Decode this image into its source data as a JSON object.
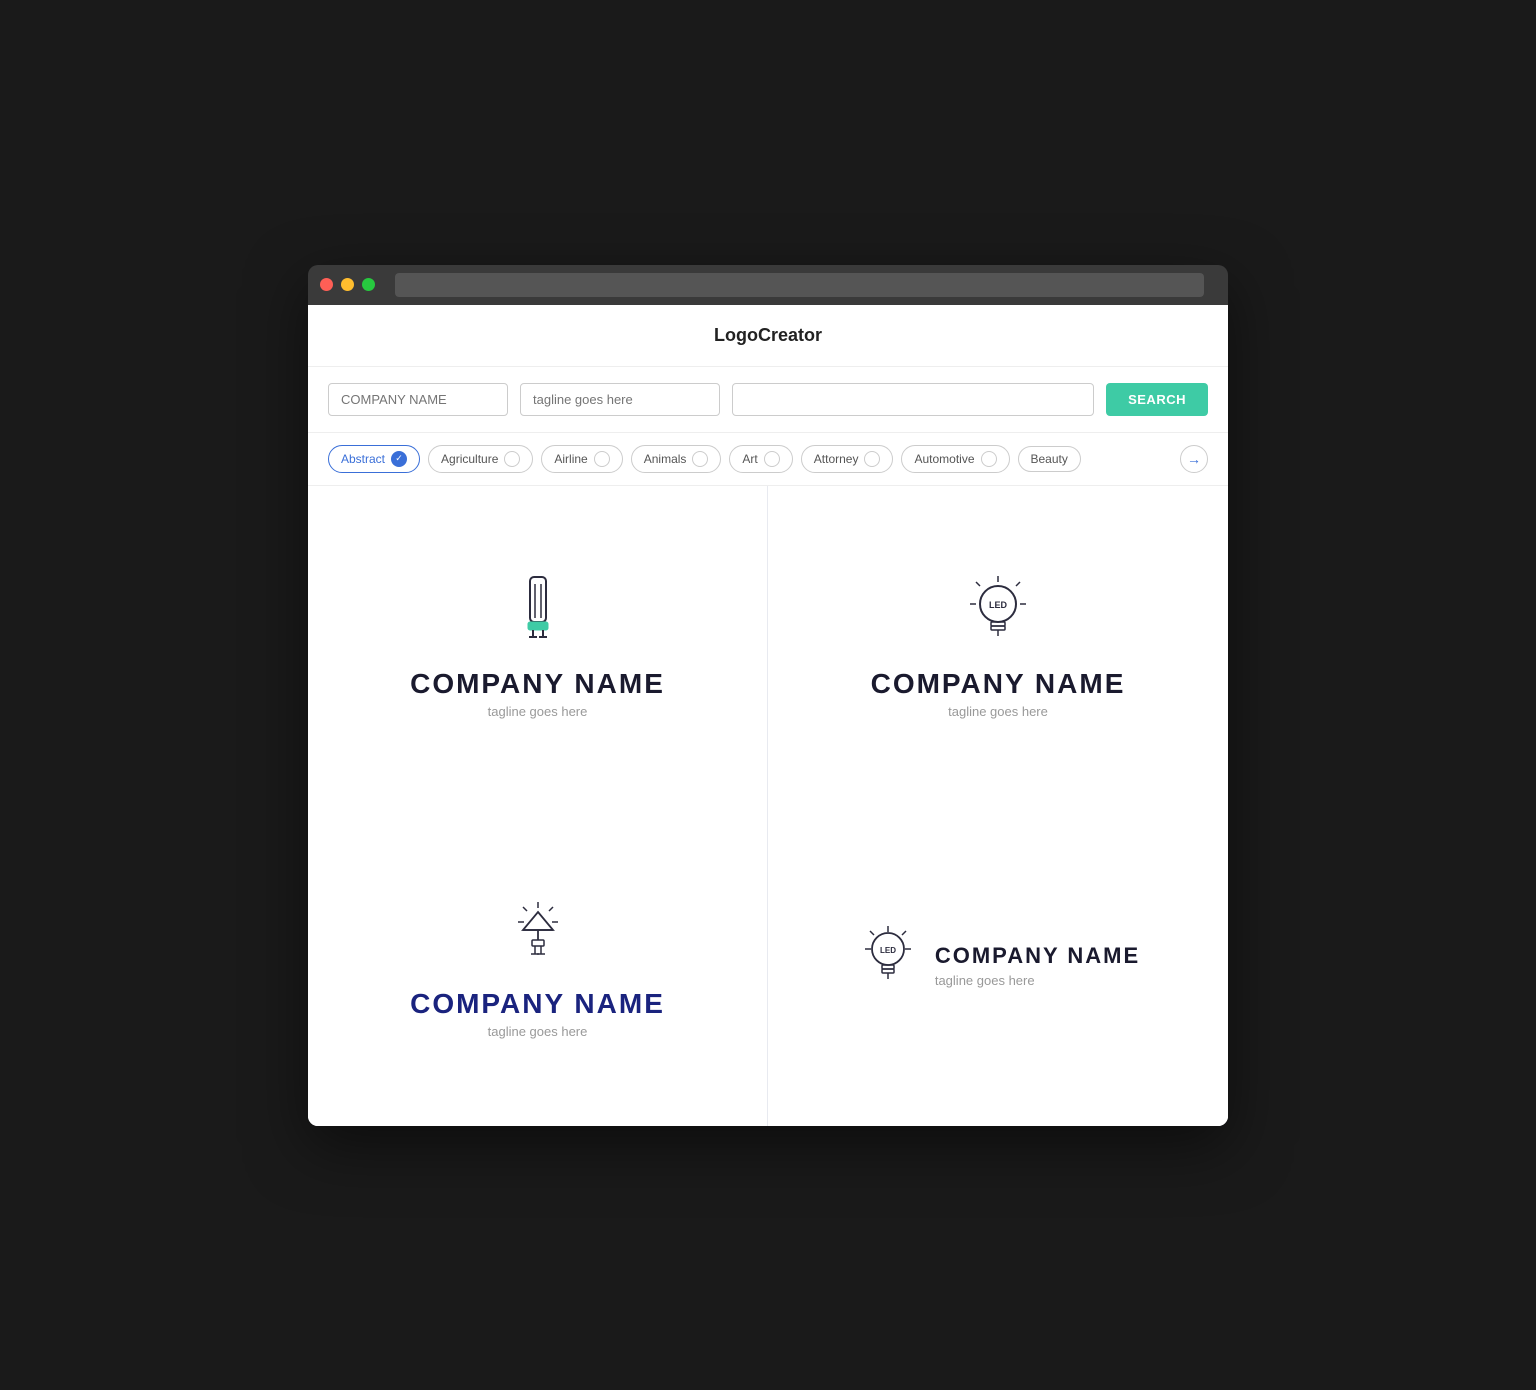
{
  "app": {
    "title": "LogoCreator"
  },
  "search": {
    "company_placeholder": "COMPANY NAME",
    "tagline_placeholder": "tagline goes here",
    "style_placeholder": "",
    "button_label": "SEARCH"
  },
  "categories": [
    {
      "id": "abstract",
      "label": "Abstract",
      "active": true
    },
    {
      "id": "agriculture",
      "label": "Agriculture",
      "active": false
    },
    {
      "id": "airline",
      "label": "Airline",
      "active": false
    },
    {
      "id": "animals",
      "label": "Animals",
      "active": false
    },
    {
      "id": "art",
      "label": "Art",
      "active": false
    },
    {
      "id": "attorney",
      "label": "Attorney",
      "active": false
    },
    {
      "id": "automotive",
      "label": "Automotive",
      "active": false
    },
    {
      "id": "beauty",
      "label": "Beauty",
      "active": false
    }
  ],
  "logos": [
    {
      "id": "logo1",
      "company": "COMPANY NAME",
      "tagline": "tagline goes here",
      "style": "centered-dark",
      "icon": "led-tube"
    },
    {
      "id": "logo2",
      "company": "COMPANY NAME",
      "tagline": "tagline goes here",
      "style": "centered-dark",
      "icon": "led-bulb"
    },
    {
      "id": "logo3",
      "company": "COMPANY NAME",
      "tagline": "tagline goes here",
      "style": "centered-navy",
      "icon": "led-component"
    },
    {
      "id": "logo4",
      "company": "COMPANY NAME",
      "tagline": "tagline goes here",
      "style": "inline-dark",
      "icon": "led-bulb-small"
    }
  ]
}
